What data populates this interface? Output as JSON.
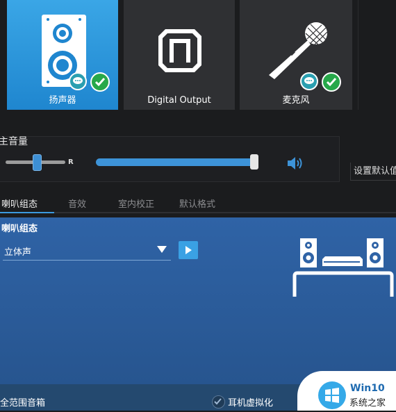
{
  "devices": [
    {
      "label": "扬声器",
      "icon": "speaker-icon",
      "active": true,
      "badges": [
        "chat-icon",
        "check-icon"
      ]
    },
    {
      "label": "Digital Output",
      "icon": "digital-output-icon",
      "active": false,
      "badges": []
    },
    {
      "label": "麦克风",
      "icon": "microphone-icon",
      "active": false,
      "badges": [
        "chat-icon",
        "check-icon"
      ]
    }
  ],
  "volume": {
    "title": "主音量",
    "balance_right_label": "R",
    "balance_level": 0.5,
    "main_level": 1.0,
    "speaker_icon": "volume-icon"
  },
  "set_default_button": "设置默认值",
  "tabs": [
    {
      "label": "喇叭组态",
      "active": true
    },
    {
      "label": "音效",
      "active": false
    },
    {
      "label": "室内校正",
      "active": false
    },
    {
      "label": "默认格式",
      "active": false
    }
  ],
  "config": {
    "title": "喇叭组态",
    "speaker_config_value": "立体声",
    "play_icon": "play-icon",
    "illustration": "stereo-speakers-icon"
  },
  "bottom": {
    "full_range_label": "全范围音箱",
    "headphone_virtualization_label": "耳机虚拟化",
    "headphone_virtualization_checked": true
  },
  "watermark": {
    "line1": "Win10",
    "line2": "系统之家"
  },
  "colors": {
    "accent": "#3a9fe4",
    "panel_blue": "#2b5b9a",
    "background": "#1b1c1e"
  }
}
